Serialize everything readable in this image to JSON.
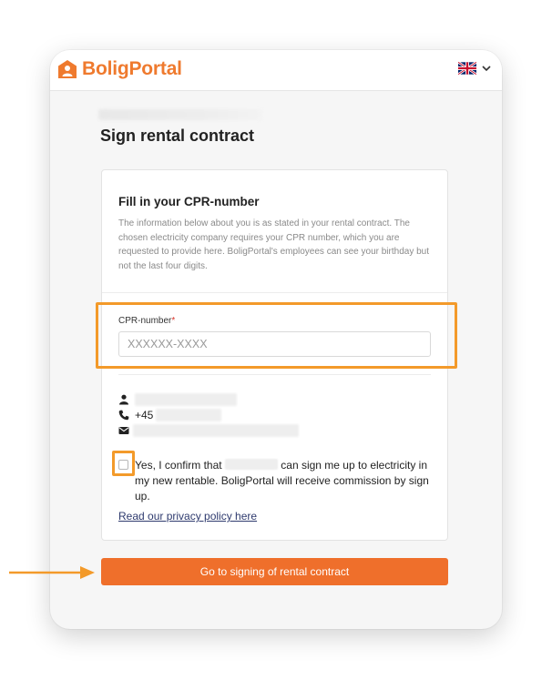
{
  "brand": {
    "name": "BoligPortal",
    "color": "#ef7a2e"
  },
  "language": {
    "flag_icon": "uk-flag-icon",
    "chevron_icon": "chevron-down-icon"
  },
  "page": {
    "title": "Sign rental contract"
  },
  "card": {
    "title": "Fill in your CPR-number",
    "description": "The information below about you is as stated in your rental contract. The chosen electricity company requires your CPR number, which you are requested to provide here. BoligPortal's employees can see your birthday but not the last four digits.",
    "cpr_label": "CPR-number",
    "required_marker": "*",
    "cpr_placeholder": "XXXXXX-XXXX",
    "contact": {
      "name_icon": "person-icon",
      "phone_icon": "phone-icon",
      "phone_prefix": "+45",
      "email_icon": "envelope-icon"
    },
    "consent": {
      "before": "Yes, I confirm that ",
      "after": " can sign me up to electricity in my new rentable. BoligPortal will receive commission by sign up."
    },
    "privacy_link": "Read our privacy policy here"
  },
  "cta": {
    "label": "Go to signing of rental contract",
    "color": "#ef6f2b"
  },
  "annotation": {
    "highlight_color": "#f39a2a"
  }
}
